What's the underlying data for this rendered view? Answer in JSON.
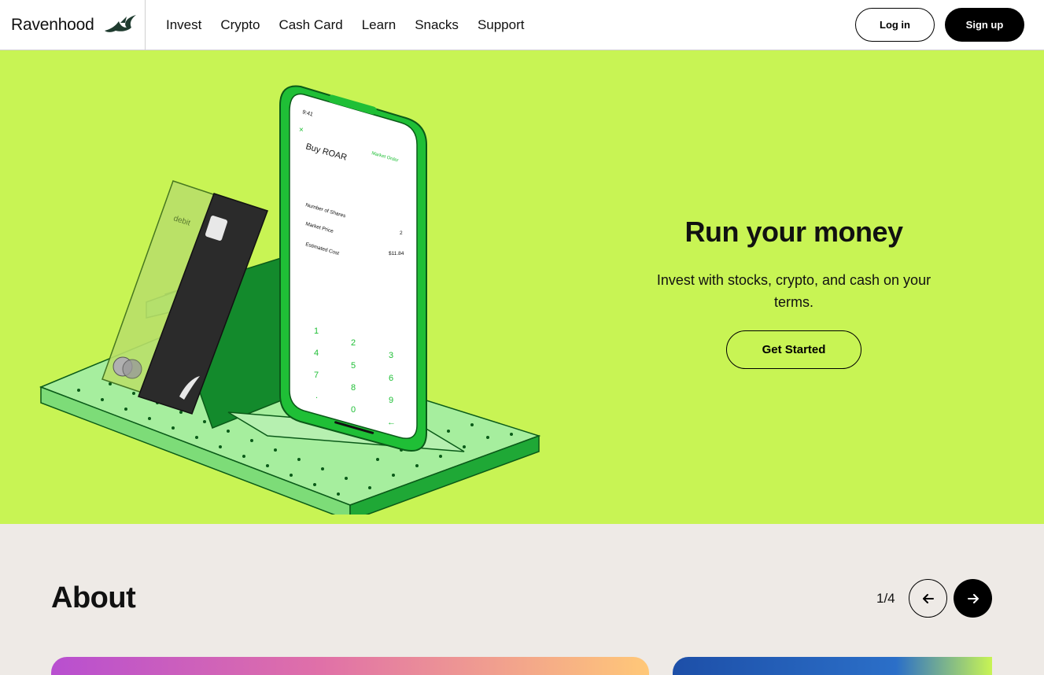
{
  "nav": {
    "brand": "Ravenhood",
    "items": [
      "Invest",
      "Crypto",
      "Cash Card",
      "Learn",
      "Snacks",
      "Support"
    ],
    "login_label": "Log in",
    "signup_label": "Sign up"
  },
  "hero": {
    "title": "Run your money",
    "subtitle": "Invest with stocks, crypto, and cash on your terms.",
    "cta_label": "Get Started",
    "illustration": {
      "phone_time": "9:41",
      "order_title": "Buy ROAR",
      "order_type": "Market Order",
      "rows": [
        "Number of Shares",
        "Market Price",
        "Estimated Cost"
      ],
      "row_values": [
        "2",
        "$11.84"
      ],
      "keypad": [
        "1",
        "2",
        "3",
        "4",
        "5",
        "6",
        "7",
        "8",
        "9",
        ".",
        "0",
        "←"
      ],
      "card_label": "debit"
    },
    "colors": {
      "background": "#c8f454",
      "accent": "#22c322"
    }
  },
  "about": {
    "title": "About",
    "pager": "1/4",
    "prev_icon": "arrow-left-icon",
    "next_icon": "arrow-right-icon"
  }
}
